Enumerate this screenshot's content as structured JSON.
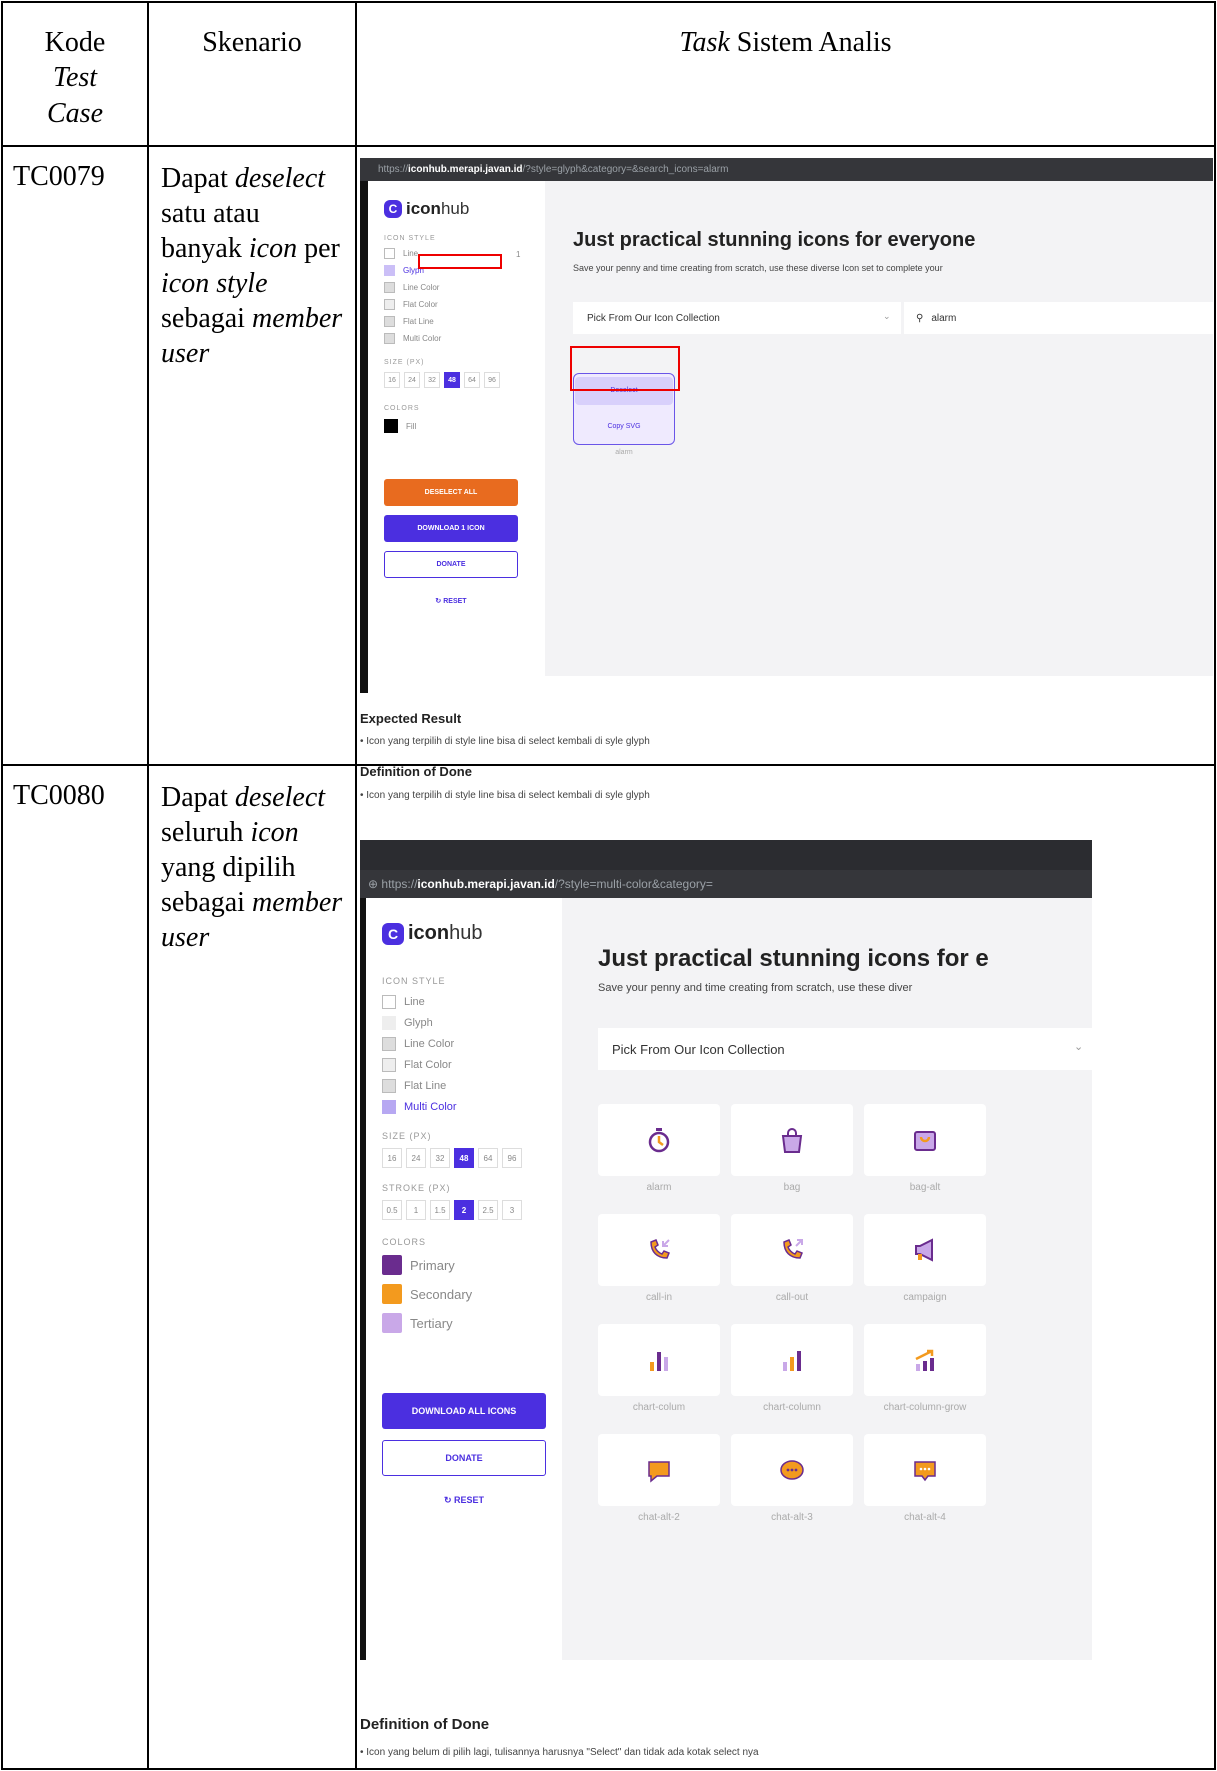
{
  "table": {
    "headers": {
      "kode_line1": "Kode",
      "kode_line2": "Test",
      "kode_line3": "Case",
      "skenario": "Skenario",
      "task_em": "Task",
      "task_rest": " Sistem Analis"
    }
  },
  "tc79": {
    "code": "TC0079",
    "scenario": {
      "p1": "Dapat ",
      "p2": "deselect",
      "p3": " satu atau banyak ",
      "p4": "icon",
      "p5": " per ",
      "p6": "icon style",
      "p7": " sebagai ",
      "p8": "member user"
    },
    "shot": {
      "url_prefix": "https://",
      "url_host": "iconhub.merapi.javan.id",
      "url_rest": "/?style=glyph&category=&search_icons=alarm",
      "logo_icon": "C",
      "logo_bold": "icon",
      "logo_rest": "hub",
      "icon_style_label": "ICON STYLE",
      "styles": [
        "Line",
        "Glyph",
        "Line Color",
        "Flat Color",
        "Flat Line",
        "Multi Color"
      ],
      "line_count": "1",
      "size_label": "SIZE (PX)",
      "sizes": [
        "16",
        "24",
        "32",
        "48",
        "64",
        "96"
      ],
      "colors_label": "COLORS",
      "fill_label": "Fill",
      "deselect_all": "DESELECT ALL",
      "download": "DOWNLOAD 1 ICON",
      "donate": "DONATE",
      "reset": "RESET",
      "headline": "Just practical stunning icons for everyone",
      "subline": "Save your penny and time creating from scratch, use these diverse Icon set to complete your",
      "collection": "Pick From Our Icon Collection",
      "search_value": "alarm",
      "deselect_btn": "Deselect",
      "copy_svg": "Copy SVG",
      "icon_name": "alarm",
      "colors": {
        "accent": "#4b2fe0",
        "orange": "#e86b1f",
        "selected_tile": "#d8d0fb"
      }
    },
    "expected_title": "Expected Result",
    "expected_item": "Icon yang terpilih di style line bisa di select kembali di syle glyph",
    "dod_title": "Definition of Done",
    "dod_item": "Icon yang terpilih di style line bisa di select kembali di syle glyph"
  },
  "tc80": {
    "code": "TC0080",
    "scenario": {
      "p1": "Dapat ",
      "p2": "deselect",
      "p3": " seluruh ",
      "p4": "icon",
      "p5": " yang dipilih sebagai ",
      "p6": "member user"
    },
    "shot": {
      "url_prefix": "https://",
      "url_host": "iconhub.merapi.javan.id",
      "url_rest": "/?style=multi-color&category=",
      "logo_icon": "C",
      "logo_bold": "icon",
      "logo_rest": "hub",
      "icon_style_label": "ICON STYLE",
      "styles": [
        "Line",
        "Glyph",
        "Line Color",
        "Flat Color",
        "Flat Line",
        "Multi Color"
      ],
      "size_label": "SIZE (PX)",
      "sizes": [
        "16",
        "24",
        "32",
        "48",
        "64",
        "96"
      ],
      "stroke_label": "STROKE (PX)",
      "strokes": [
        "0.5",
        "1",
        "1.5",
        "2",
        "2.5",
        "3"
      ],
      "colors_label": "COLORS",
      "color_names": [
        "Primary",
        "Secondary",
        "Tertiary"
      ],
      "color_values": [
        "#6a2c8e",
        "#f39a1e",
        "#c9a8e8"
      ],
      "download": "DOWNLOAD ALL ICONS",
      "donate": "DONATE",
      "reset": "RESET",
      "headline": "Just practical stunning icons for e",
      "subline": "Save your penny and time creating from scratch, use these diver",
      "collection": "Pick From Our Icon Collection",
      "icons": [
        "alarm",
        "bag",
        "bag-alt",
        "call-in",
        "call-out",
        "campaign",
        "chart-colum",
        "chart-column",
        "chart-column-grow",
        "chat-alt-2",
        "chat-alt-3",
        "chat-alt-4"
      ]
    },
    "dod_title": "Definition of Done",
    "dod_item": "Icon yang belum di pilih lagi, tulisannya harusnya \"Select\" dan tidak ada kotak select nya"
  }
}
